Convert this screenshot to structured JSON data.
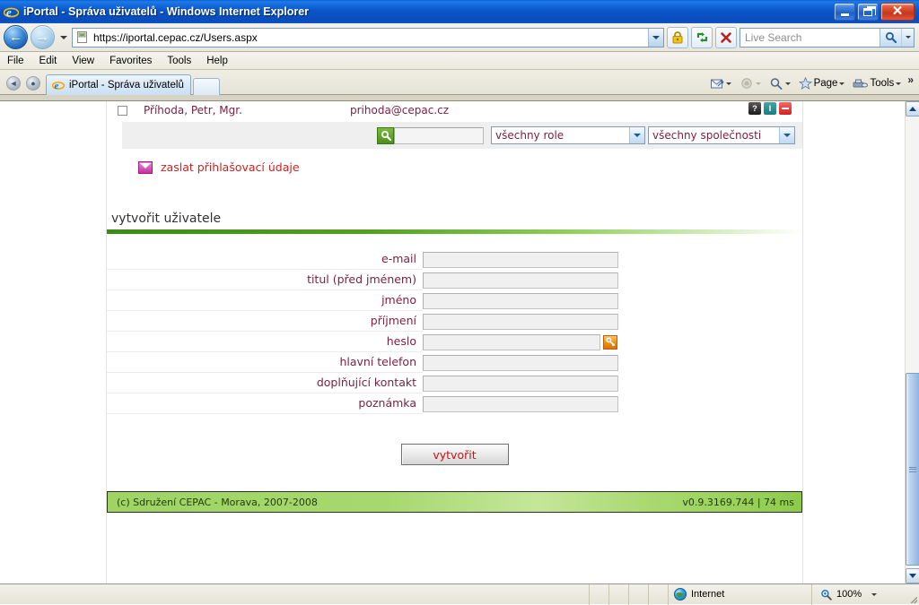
{
  "window": {
    "title": "iPortal - Správa uživatelů - Windows Internet Explorer",
    "ie_icon": "ie-logo-icon",
    "controls": {
      "minimize": "minimize-button",
      "restore": "restore-button",
      "close_label": "✕"
    }
  },
  "navigation": {
    "back_glyph": "←",
    "forward_glyph": "→",
    "url": "https://iportal.cepac.cz/Users.aspx",
    "icons": {
      "history_dropdown": "chevron-down-icon",
      "lock": "padlock-icon",
      "refresh": "refresh-icon",
      "stop": "stop-icon",
      "favicon": "page-favicon-icon",
      "url_dropdown": "chevron-down-icon"
    }
  },
  "search": {
    "placeholder": "Live Search",
    "go_icon": "search-magnifier-icon",
    "dropdown_icon": "chevron-down-icon"
  },
  "menu": {
    "items": [
      "File",
      "Edit",
      "View",
      "Favorites",
      "Tools",
      "Help"
    ]
  },
  "tabs": {
    "quick_back": "quick-tab-back-icon",
    "quick_list": "quick-tab-list-icon",
    "active": {
      "label": "iPortal - Správa uživatelů",
      "icon": "ie-page-icon"
    },
    "new_tab": "new-tab-button"
  },
  "command_bar": {
    "buttons": [
      {
        "name": "mail-button",
        "label": "",
        "icon": "mail-icon",
        "dim": false,
        "caret": true
      },
      {
        "name": "print-button",
        "label": "",
        "icon": "print-icon",
        "dim": true,
        "caret": true
      },
      {
        "name": "search-button",
        "label": "",
        "icon": "magnifier-icon",
        "dim": false,
        "caret": true
      },
      {
        "name": "page-button",
        "label": "Page",
        "icon": "star-icon",
        "dim": false,
        "caret": true
      },
      {
        "name": "tools-button",
        "label": "Tools",
        "icon": "tools-icon",
        "dim": false,
        "caret": true
      }
    ],
    "overflow": "»"
  },
  "page": {
    "user_row": {
      "name": "Příhoda, Petr, Mgr.",
      "email": "prihoda@cepac.cz",
      "actions": {
        "help": "?",
        "info": "I",
        "delete": "−"
      }
    },
    "filter_row": {
      "search_icon": "search-magnifier-icon",
      "query_value": "",
      "role_select": "všechny role",
      "company_select": "všechny společnosti"
    },
    "mail_link": {
      "icon": "envelope-icon",
      "label": "zaslat přihlašovací údaje"
    },
    "section": {
      "title": "vytvořit uživatele"
    },
    "form": {
      "fields": [
        {
          "label": "e-mail",
          "value": "",
          "name": "email-field"
        },
        {
          "label": "titul (před jménem)",
          "value": "",
          "name": "title-prefix-field"
        },
        {
          "label": "jméno",
          "value": "",
          "name": "firstname-field"
        },
        {
          "label": "příjmení",
          "value": "",
          "name": "lastname-field"
        },
        {
          "label": "heslo",
          "value": "",
          "name": "password-field",
          "key_button": "generate-password-icon"
        },
        {
          "label": "hlavní telefon",
          "value": "",
          "name": "main-phone-field"
        },
        {
          "label": "doplňující kontakt",
          "value": "",
          "name": "additional-contact-field"
        },
        {
          "label": "poznámka",
          "value": "",
          "name": "note-field"
        }
      ],
      "submit_label": "vytvořit"
    },
    "footer": {
      "copyright": "(c) Sdružení CEPAC - Morava, 2007-2008",
      "version": "v0.9.3169.744 | 74 ms"
    }
  },
  "statusbar": {
    "zone_label": "Internet",
    "zone_icon": "globe-icon",
    "zoom_label": "100%",
    "zoom_icon": "zoom-magnifier-icon",
    "zoom_caret": "chevron-down-icon"
  },
  "scrollbar": {
    "up": "scroll-up-arrow-icon",
    "down": "scroll-down-arrow-icon",
    "thumb": "scroll-thumb"
  },
  "colors": {
    "brand_green": "#4e8f1d",
    "link_red": "#cc2222",
    "label_maroon": "#7a1f3d",
    "title_blue": "#0a55c8"
  }
}
